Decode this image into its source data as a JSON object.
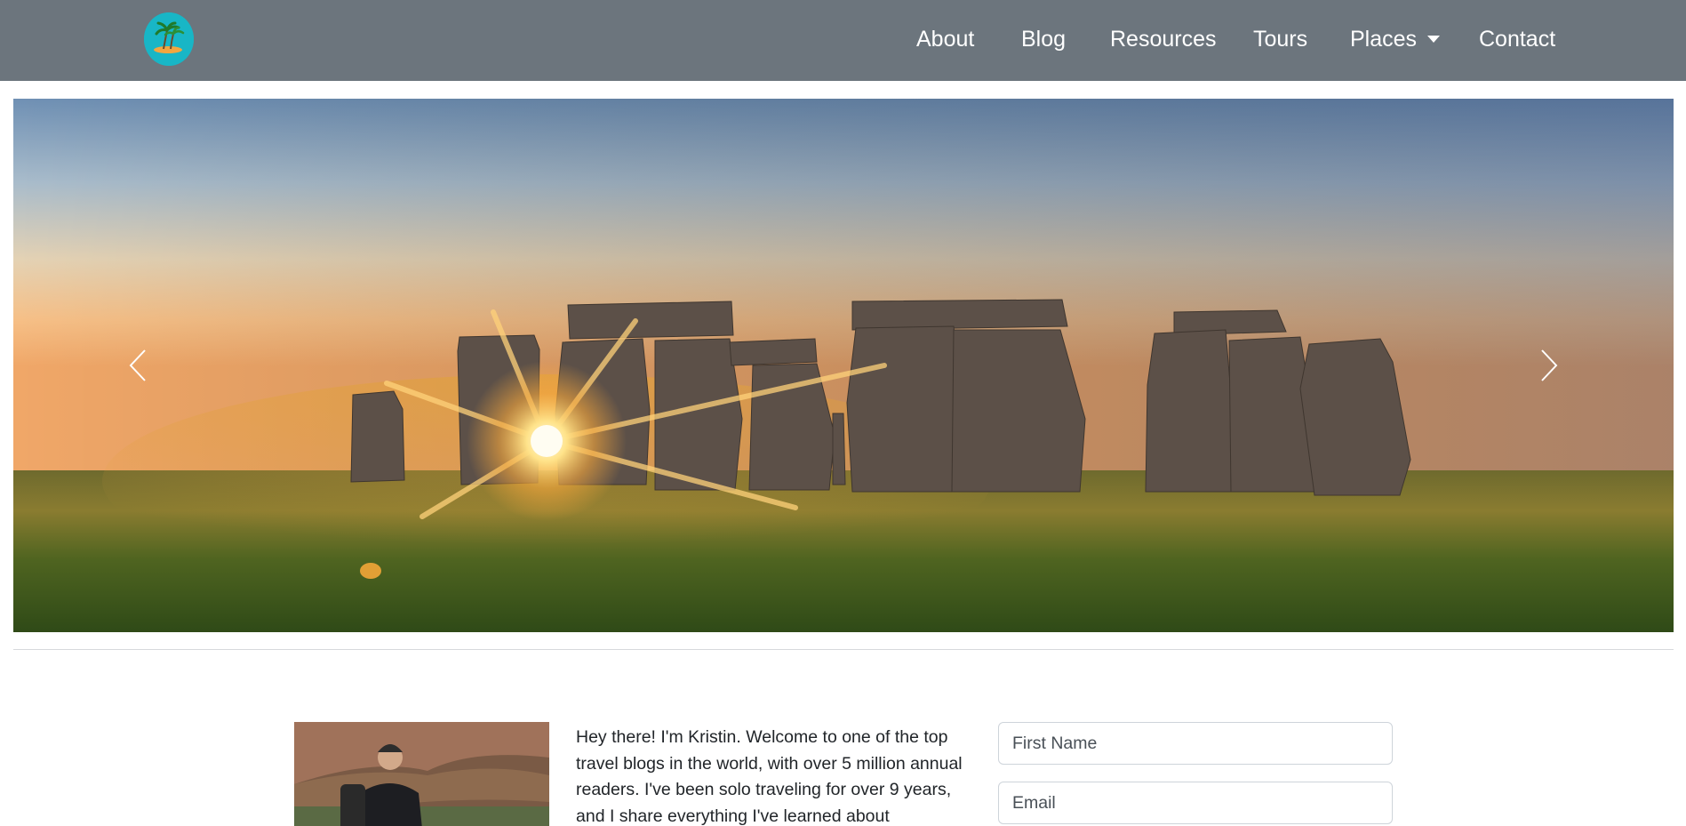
{
  "navbar": {
    "brand_icon": "island-palm-logo-icon",
    "links": [
      {
        "label": "About"
      },
      {
        "label": "Blog"
      },
      {
        "label": "Resources"
      },
      {
        "label": "Tours"
      },
      {
        "label": "Places",
        "dropdown": true
      },
      {
        "label": "Contact"
      }
    ],
    "bg_color": "#6c757d"
  },
  "carousel": {
    "slide_image": "stonehenge-sunset-photo",
    "prev_icon": "chevron-left-icon",
    "next_icon": "chevron-right-icon"
  },
  "intro": {
    "photo": "hiker-portrait-photo",
    "text": "Hey there! I'm Kristin. Welcome to one of the top travel blogs in the world, with over 5 million annual readers. I've been solo traveling for over 9 years, and I share everything I've learned about"
  },
  "signup_form": {
    "first_name_placeholder": "First Name",
    "email_placeholder": "Email"
  }
}
